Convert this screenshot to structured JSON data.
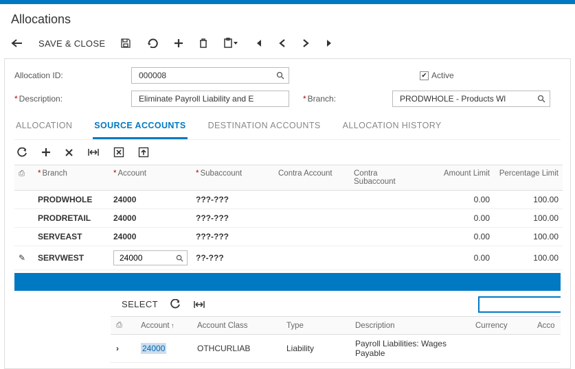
{
  "page_title": "Allocations",
  "toolbar": {
    "save_close": "SAVE & CLOSE"
  },
  "form": {
    "allocation_id_label": "Allocation ID:",
    "allocation_id_value": "000008",
    "description_label": "Description:",
    "description_value": "Eliminate Payroll Liability and E",
    "branch_label": "Branch:",
    "branch_value": "PRODWHOLE - Products Wl",
    "active_label": "Active",
    "active_checked": "✔"
  },
  "tabs": {
    "allocation": "ALLOCATION",
    "source_accounts": "SOURCE ACCOUNTS",
    "destination_accounts": "DESTINATION ACCOUNTS",
    "allocation_history": "ALLOCATION HISTORY"
  },
  "grid": {
    "headers": {
      "branch": "Branch",
      "account": "Account",
      "subaccount": "Subaccount",
      "contra_account": "Contra Account",
      "contra_subaccount": "Contra Subaccount",
      "amount_limit": "Amount Limit",
      "percentage_limit": "Percentage Limit"
    },
    "rows": [
      {
        "branch": "PRODWHOLE",
        "account": "24000",
        "subaccount": "???-???",
        "amount": "0.00",
        "pct": "100.00"
      },
      {
        "branch": "PRODRETAIL",
        "account": "24000",
        "subaccount": "???-???",
        "amount": "0.00",
        "pct": "100.00"
      },
      {
        "branch": "SERVEAST",
        "account": "24000",
        "subaccount": "???-???",
        "amount": "0.00",
        "pct": "100.00"
      },
      {
        "branch": "SERVWEST",
        "account": "24000",
        "subaccount": "??-???",
        "amount": "0.00",
        "pct": "100.00"
      }
    ]
  },
  "popup": {
    "select_label": "SELECT",
    "headers": {
      "account": "Account",
      "account_class": "Account Class",
      "type": "Type",
      "description": "Description",
      "currency": "Currency",
      "acco": "Acco"
    },
    "row": {
      "account": "24000",
      "account_class": "OTHCURLIAB",
      "type": "Liability",
      "description": "Payroll Liabilities: Wages Payable"
    },
    "search_value": ""
  }
}
